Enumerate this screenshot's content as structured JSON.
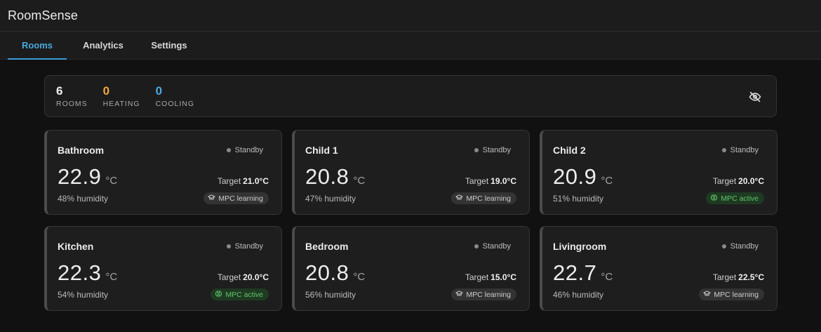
{
  "app": {
    "title": "RoomSense"
  },
  "tabs": [
    {
      "label": "Rooms",
      "active": true
    },
    {
      "label": "Analytics",
      "active": false
    },
    {
      "label": "Settings",
      "active": false
    }
  ],
  "summary": {
    "rooms": {
      "value": "6",
      "label": "ROOMS"
    },
    "heating": {
      "value": "0",
      "label": "HEATING"
    },
    "cooling": {
      "value": "0",
      "label": "COOLING"
    },
    "toggle_icon": "eye-off-icon"
  },
  "rooms": [
    {
      "name": "Bathroom",
      "status": "Standby",
      "temperature": "22.9",
      "unit": "°C",
      "target_label": "Target",
      "target": "21.0°C",
      "humidity": "48% humidity",
      "mpc": "MPC learning",
      "mpc_state": "learning"
    },
    {
      "name": "Child 1",
      "status": "Standby",
      "temperature": "20.8",
      "unit": "°C",
      "target_label": "Target",
      "target": "19.0°C",
      "humidity": "47% humidity",
      "mpc": "MPC learning",
      "mpc_state": "learning"
    },
    {
      "name": "Child 2",
      "status": "Standby",
      "temperature": "20.9",
      "unit": "°C",
      "target_label": "Target",
      "target": "20.0°C",
      "humidity": "51% humidity",
      "mpc": "MPC active",
      "mpc_state": "active"
    },
    {
      "name": "Kitchen",
      "status": "Standby",
      "temperature": "22.3",
      "unit": "°C",
      "target_label": "Target",
      "target": "20.0°C",
      "humidity": "54% humidity",
      "mpc": "MPC active",
      "mpc_state": "active"
    },
    {
      "name": "Bedroom",
      "status": "Standby",
      "temperature": "20.8",
      "unit": "°C",
      "target_label": "Target",
      "target": "15.0°C",
      "humidity": "56% humidity",
      "mpc": "MPC learning",
      "mpc_state": "learning"
    },
    {
      "name": "Livingroom",
      "status": "Standby",
      "temperature": "22.7",
      "unit": "°C",
      "target_label": "Target",
      "target": "22.5°C",
      "humidity": "46% humidity",
      "mpc": "MPC learning",
      "mpc_state": "learning"
    }
  ],
  "colors": {
    "accent": "#3a9ad9",
    "heating": "#f3a93c",
    "cooling": "#4aa8e0",
    "mpc_active": "#62c46b"
  }
}
